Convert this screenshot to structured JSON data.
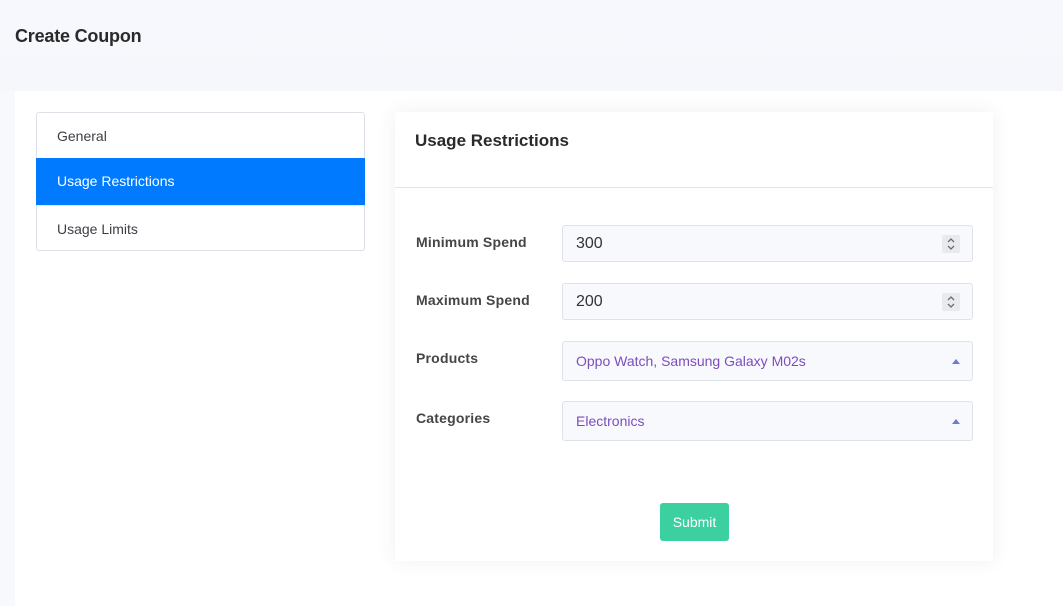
{
  "header": {
    "title": "Create Coupon"
  },
  "sidebar": {
    "items": [
      {
        "label": "General",
        "active": false
      },
      {
        "label": "Usage Restrictions",
        "active": true
      },
      {
        "label": "Usage Limits",
        "active": false
      }
    ]
  },
  "form": {
    "title": "Usage Restrictions",
    "fields": {
      "minimum_spend": {
        "label": "Minimum Spend",
        "value": "300"
      },
      "maximum_spend": {
        "label": "Maximum Spend",
        "value": "200"
      },
      "products": {
        "label": "Products",
        "value": "Oppo Watch, Samsung Galaxy M02s"
      },
      "categories": {
        "label": "Categories",
        "value": "Electronics"
      }
    },
    "submit_label": "Submit"
  },
  "colors": {
    "accent": "#007bff",
    "submit": "#3ccf9f",
    "select_text": "#7c4dbc"
  },
  "icons": {
    "spinner": "up-down-arrows-icon",
    "dropdown": "caret-up-icon"
  }
}
